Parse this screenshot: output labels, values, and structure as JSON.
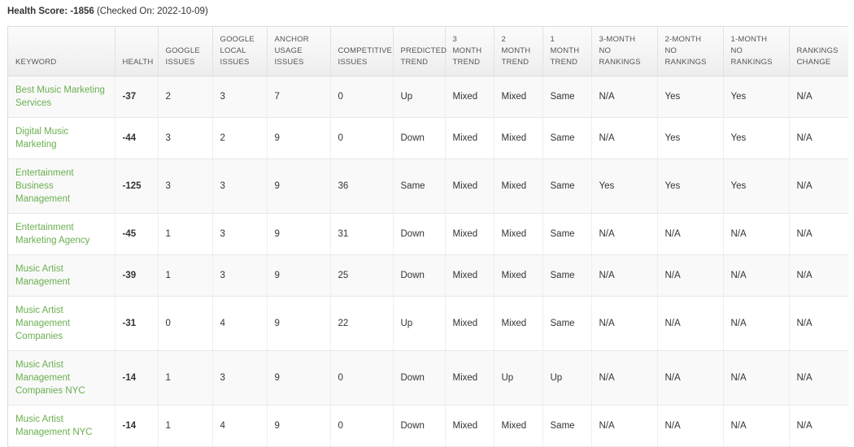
{
  "health_summary": {
    "label": "Health Score:",
    "value": "-1856",
    "checked_on": "(Checked On: 2022-10-09)"
  },
  "colors": {
    "keyword_link": "#6aaf50",
    "header_text": "#555555",
    "body_text": "#333333",
    "row_odd_bg": "#f9f9f9",
    "row_even_bg": "#ffffff",
    "border": "#dddddd"
  },
  "table": {
    "columns": [
      {
        "key": "keyword",
        "label": "KEYWORD"
      },
      {
        "key": "health",
        "label": "HEALTH"
      },
      {
        "key": "gi",
        "label": "GOOGLE ISSUES"
      },
      {
        "key": "gli",
        "label": "GOOGLE LOCAL ISSUES"
      },
      {
        "key": "aui",
        "label": "ANCHOR USAGE ISSUES"
      },
      {
        "key": "ci",
        "label": "COMPETITIVE ISSUES"
      },
      {
        "key": "pt",
        "label": "PREDICTED TREND"
      },
      {
        "key": "t3m",
        "label": "3 MONTH TREND"
      },
      {
        "key": "t2m",
        "label": "2 MONTH TREND"
      },
      {
        "key": "t1m",
        "label": "1 MONTH TREND"
      },
      {
        "key": "nr3m",
        "label": "3-MONTH NO RANKINGS"
      },
      {
        "key": "nr2m",
        "label": "2-MONTH NO RANKINGS"
      },
      {
        "key": "nr1m",
        "label": "1-MONTH NO RANKINGS"
      },
      {
        "key": "rc",
        "label": "RANKINGS CHANGE"
      }
    ],
    "rows": [
      {
        "keyword": "Best Music Marketing Services",
        "health": "-37",
        "gi": "2",
        "gli": "3",
        "aui": "7",
        "ci": "0",
        "pt": "Up",
        "t3m": "Mixed",
        "t2m": "Mixed",
        "t1m": "Same",
        "nr3m": "N/A",
        "nr2m": "Yes",
        "nr1m": "Yes",
        "rc": "N/A"
      },
      {
        "keyword": "Digital Music Marketing",
        "health": "-44",
        "gi": "3",
        "gli": "2",
        "aui": "9",
        "ci": "0",
        "pt": "Down",
        "t3m": "Mixed",
        "t2m": "Mixed",
        "t1m": "Same",
        "nr3m": "N/A",
        "nr2m": "Yes",
        "nr1m": "Yes",
        "rc": "N/A"
      },
      {
        "keyword": "Entertainment Business Management",
        "health": "-125",
        "gi": "3",
        "gli": "3",
        "aui": "9",
        "ci": "36",
        "pt": "Same",
        "t3m": "Mixed",
        "t2m": "Mixed",
        "t1m": "Same",
        "nr3m": "Yes",
        "nr2m": "Yes",
        "nr1m": "Yes",
        "rc": "N/A"
      },
      {
        "keyword": "Entertainment Marketing Agency",
        "health": "-45",
        "gi": "1",
        "gli": "3",
        "aui": "9",
        "ci": "31",
        "pt": "Down",
        "t3m": "Mixed",
        "t2m": "Mixed",
        "t1m": "Same",
        "nr3m": "N/A",
        "nr2m": "N/A",
        "nr1m": "N/A",
        "rc": "N/A"
      },
      {
        "keyword": "Music Artist Management",
        "health": "-39",
        "gi": "1",
        "gli": "3",
        "aui": "9",
        "ci": "25",
        "pt": "Down",
        "t3m": "Mixed",
        "t2m": "Mixed",
        "t1m": "Same",
        "nr3m": "N/A",
        "nr2m": "N/A",
        "nr1m": "N/A",
        "rc": "N/A"
      },
      {
        "keyword": "Music Artist Management Companies",
        "health": "-31",
        "gi": "0",
        "gli": "4",
        "aui": "9",
        "ci": "22",
        "pt": "Up",
        "t3m": "Mixed",
        "t2m": "Mixed",
        "t1m": "Same",
        "nr3m": "N/A",
        "nr2m": "N/A",
        "nr1m": "N/A",
        "rc": "N/A"
      },
      {
        "keyword": "Music Artist Management Companies NYC",
        "health": "-14",
        "gi": "1",
        "gli": "3",
        "aui": "9",
        "ci": "0",
        "pt": "Down",
        "t3m": "Mixed",
        "t2m": "Up",
        "t1m": "Up",
        "nr3m": "N/A",
        "nr2m": "N/A",
        "nr1m": "N/A",
        "rc": "N/A"
      },
      {
        "keyword": "Music Artist Management NYC",
        "health": "-14",
        "gi": "1",
        "gli": "4",
        "aui": "9",
        "ci": "0",
        "pt": "Down",
        "t3m": "Mixed",
        "t2m": "Mixed",
        "t1m": "Same",
        "nr3m": "N/A",
        "nr2m": "N/A",
        "nr1m": "N/A",
        "rc": "N/A"
      }
    ]
  }
}
